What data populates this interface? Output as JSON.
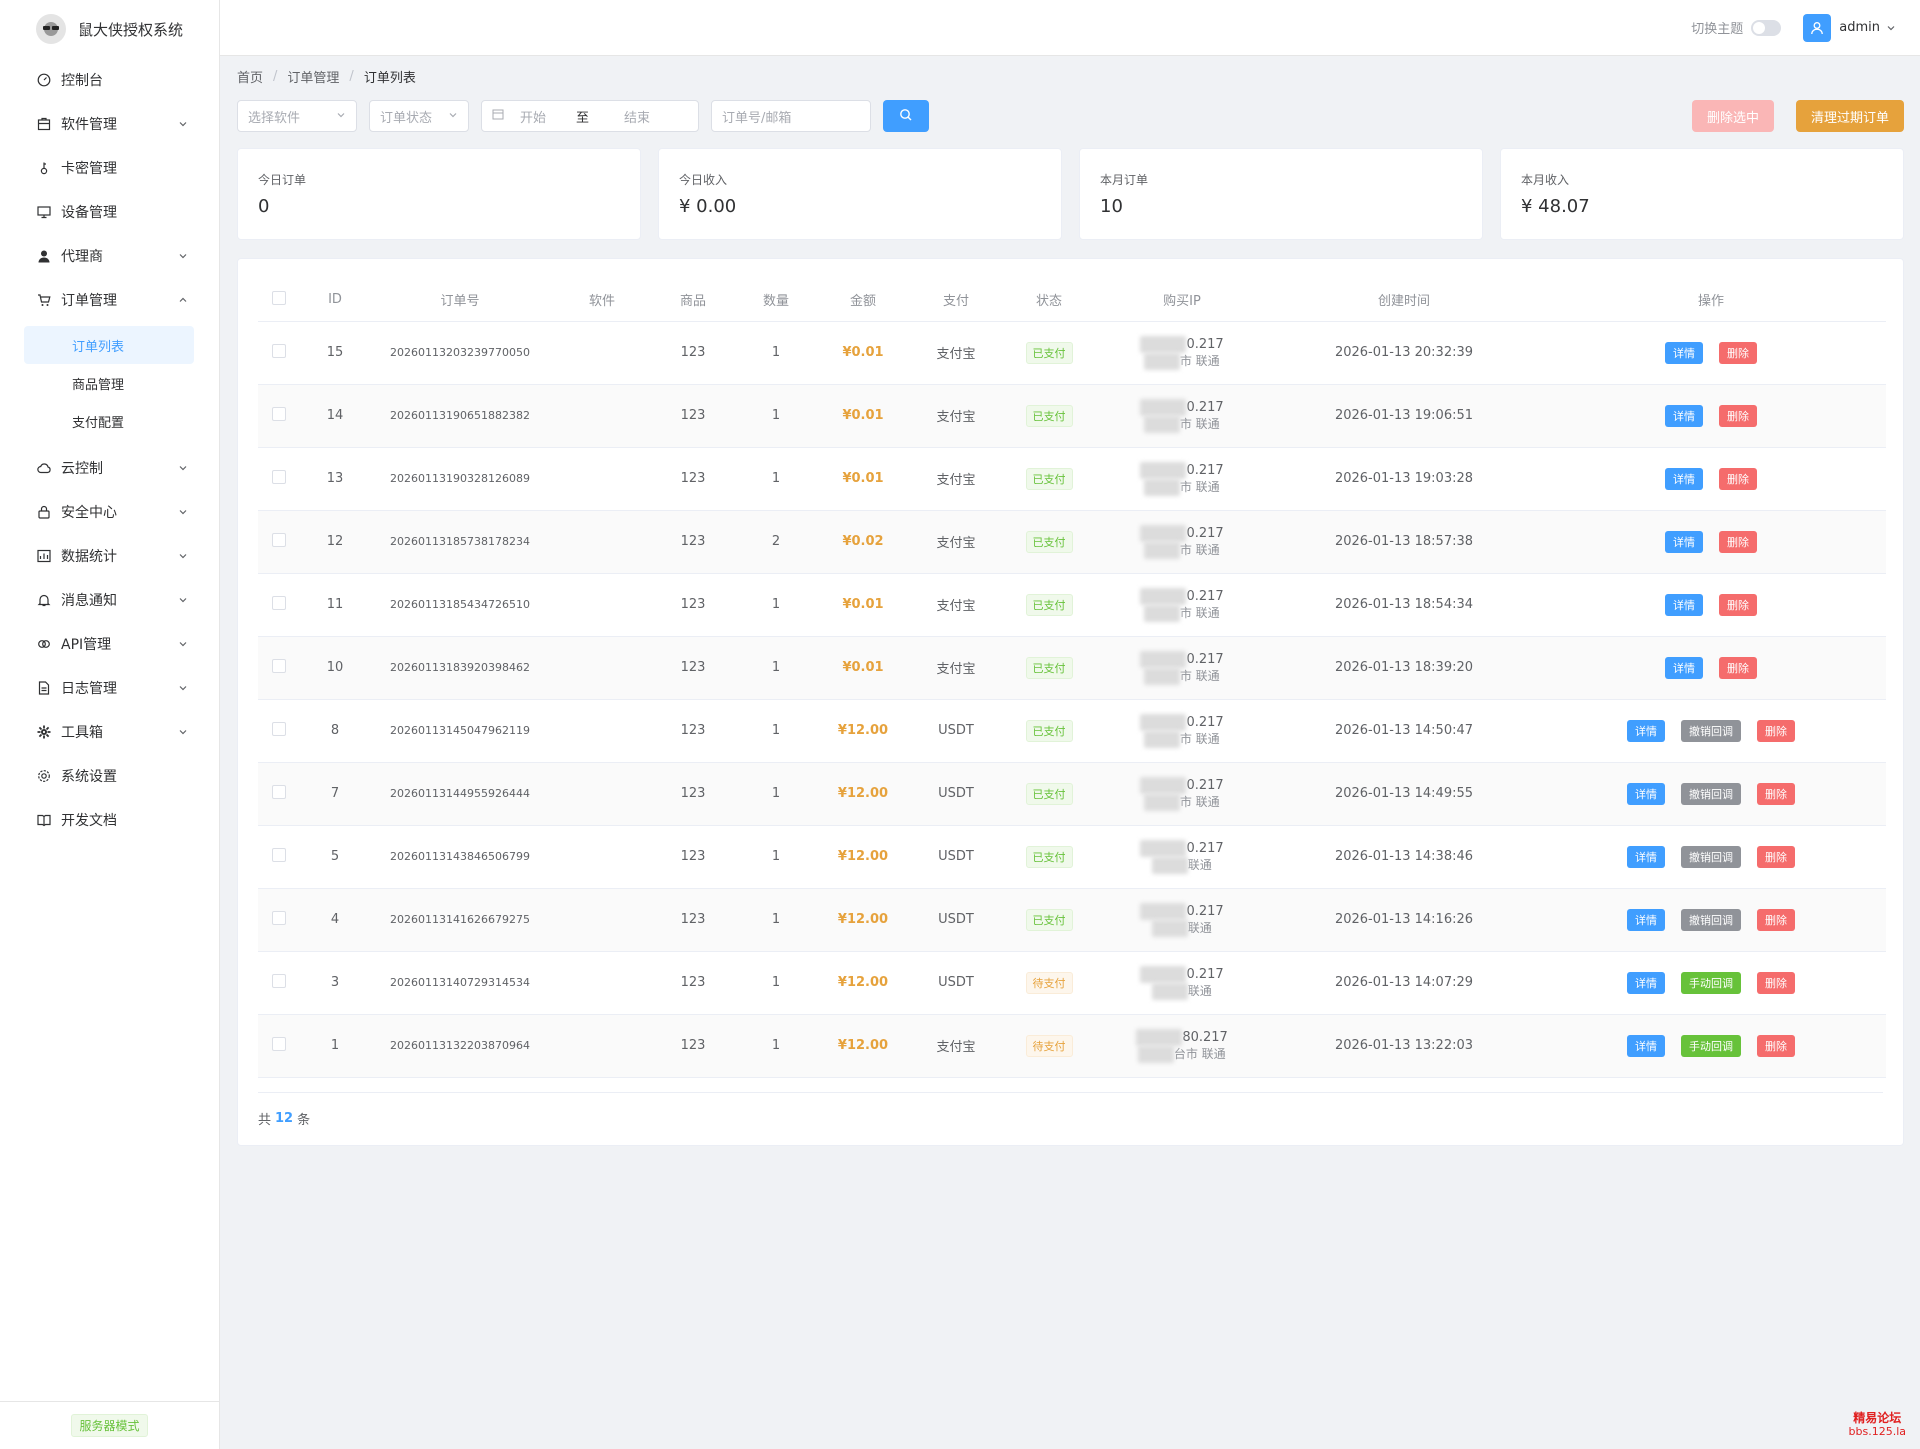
{
  "app": {
    "title": "鼠大侠授权系统"
  },
  "sidebar": {
    "items": [
      {
        "label": "控制台",
        "icon": "dashboard-icon",
        "arrow": false
      },
      {
        "label": "软件管理",
        "icon": "package-icon",
        "arrow": true
      },
      {
        "label": "卡密管理",
        "icon": "key-icon",
        "arrow": false
      },
      {
        "label": "设备管理",
        "icon": "monitor-icon",
        "arrow": false
      },
      {
        "label": "代理商",
        "icon": "user-icon",
        "arrow": true
      },
      {
        "label": "订单管理",
        "icon": "cart-icon",
        "arrow": true,
        "expanded": true
      },
      {
        "label": "云控制",
        "icon": "cloud-icon",
        "arrow": true
      },
      {
        "label": "安全中心",
        "icon": "lock-icon",
        "arrow": true
      },
      {
        "label": "数据统计",
        "icon": "chart-icon",
        "arrow": true
      },
      {
        "label": "消息通知",
        "icon": "bell-icon",
        "arrow": true
      },
      {
        "label": "API管理",
        "icon": "link-icon",
        "arrow": true
      },
      {
        "label": "日志管理",
        "icon": "document-icon",
        "arrow": true
      },
      {
        "label": "工具箱",
        "icon": "tools-icon",
        "arrow": true
      },
      {
        "label": "系统设置",
        "icon": "gear-icon",
        "arrow": false
      },
      {
        "label": "开发文档",
        "icon": "book-icon",
        "arrow": false
      }
    ],
    "order_sub": [
      {
        "label": "订单列表",
        "active": true
      },
      {
        "label": "商品管理",
        "active": false
      },
      {
        "label": "支付配置",
        "active": false
      }
    ],
    "footer_badge": "服务器模式"
  },
  "header": {
    "theme_label": "切换主题",
    "user": "admin"
  },
  "breadcrumb": [
    "首页",
    "订单管理",
    "订单列表"
  ],
  "filters": {
    "software_placeholder": "选择软件",
    "status_placeholder": "订单状态",
    "date_start": "开始",
    "date_to": "至",
    "date_end": "结束",
    "search_placeholder": "订单号/邮箱"
  },
  "actions": {
    "delete_selected": "删除选中",
    "clean_expired": "清理过期订单"
  },
  "stats": [
    {
      "label": "今日订单",
      "value": "0"
    },
    {
      "label": "今日收入",
      "value": "¥ 0.00"
    },
    {
      "label": "本月订单",
      "value": "10"
    },
    {
      "label": "本月收入",
      "value": "¥ 48.07"
    }
  ],
  "table": {
    "columns": [
      "ID",
      "订单号",
      "软件",
      "商品",
      "数量",
      "金额",
      "支付",
      "状态",
      "购买IP",
      "创建时间",
      "操作"
    ],
    "ip_line2_suffix": "市 联通",
    "rows": [
      {
        "id": "15",
        "order_no": "20260113203239770050",
        "software": "",
        "product": "123",
        "qty": "1",
        "amount": "¥0.01",
        "pay": "支付宝",
        "status": "已支付",
        "status_type": "paid",
        "ip": "0.217",
        "ip2": "市 联通",
        "time": "2026-01-13 20:32:39",
        "ops": [
          "详情",
          "删除"
        ]
      },
      {
        "id": "14",
        "order_no": "20260113190651882382",
        "software": "",
        "product": "123",
        "qty": "1",
        "amount": "¥0.01",
        "pay": "支付宝",
        "status": "已支付",
        "status_type": "paid",
        "ip": "0.217",
        "ip2": "市 联通",
        "time": "2026-01-13 19:06:51",
        "ops": [
          "详情",
          "删除"
        ]
      },
      {
        "id": "13",
        "order_no": "20260113190328126089",
        "software": "",
        "product": "123",
        "qty": "1",
        "amount": "¥0.01",
        "pay": "支付宝",
        "status": "已支付",
        "status_type": "paid",
        "ip": "0.217",
        "ip2": "市 联通",
        "time": "2026-01-13 19:03:28",
        "ops": [
          "详情",
          "删除"
        ]
      },
      {
        "id": "12",
        "order_no": "20260113185738178234",
        "software": "",
        "product": "123",
        "qty": "2",
        "amount": "¥0.02",
        "pay": "支付宝",
        "status": "已支付",
        "status_type": "paid",
        "ip": "0.217",
        "ip2": "市 联通",
        "time": "2026-01-13 18:57:38",
        "ops": [
          "详情",
          "删除"
        ]
      },
      {
        "id": "11",
        "order_no": "20260113185434726510",
        "software": "",
        "product": "123",
        "qty": "1",
        "amount": "¥0.01",
        "pay": "支付宝",
        "status": "已支付",
        "status_type": "paid",
        "ip": "0.217",
        "ip2": "市 联通",
        "time": "2026-01-13 18:54:34",
        "ops": [
          "详情",
          "删除"
        ]
      },
      {
        "id": "10",
        "order_no": "20260113183920398462",
        "software": "",
        "product": "123",
        "qty": "1",
        "amount": "¥0.01",
        "pay": "支付宝",
        "status": "已支付",
        "status_type": "paid",
        "ip": "0.217",
        "ip2": "市 联通",
        "time": "2026-01-13 18:39:20",
        "ops": [
          "详情",
          "删除"
        ]
      },
      {
        "id": "8",
        "order_no": "20260113145047962119",
        "software": "",
        "product": "123",
        "qty": "1",
        "amount": "¥12.00",
        "pay": "USDT",
        "status": "已支付",
        "status_type": "paid",
        "ip": "0.217",
        "ip2": "市 联通",
        "time": "2026-01-13 14:50:47",
        "ops": [
          "详情",
          "撤销回调",
          "删除"
        ]
      },
      {
        "id": "7",
        "order_no": "20260113144955926444",
        "software": "",
        "product": "123",
        "qty": "1",
        "amount": "¥12.00",
        "pay": "USDT",
        "status": "已支付",
        "status_type": "paid",
        "ip": "0.217",
        "ip2": "市 联通",
        "time": "2026-01-13 14:49:55",
        "ops": [
          "详情",
          "撤销回调",
          "删除"
        ]
      },
      {
        "id": "5",
        "order_no": "20260113143846506799",
        "software": "",
        "product": "123",
        "qty": "1",
        "amount": "¥12.00",
        "pay": "USDT",
        "status": "已支付",
        "status_type": "paid",
        "ip": "0.217",
        "ip2": "联通",
        "time": "2026-01-13 14:38:46",
        "ops": [
          "详情",
          "撤销回调",
          "删除"
        ]
      },
      {
        "id": "4",
        "order_no": "20260113141626679275",
        "software": "",
        "product": "123",
        "qty": "1",
        "amount": "¥12.00",
        "pay": "USDT",
        "status": "已支付",
        "status_type": "paid",
        "ip": "0.217",
        "ip2": "联通",
        "time": "2026-01-13 14:16:26",
        "ops": [
          "详情",
          "撤销回调",
          "删除"
        ]
      },
      {
        "id": "3",
        "order_no": "20260113140729314534",
        "software": "",
        "product": "123",
        "qty": "1",
        "amount": "¥12.00",
        "pay": "USDT",
        "status": "待支付",
        "status_type": "pending",
        "ip": "0.217",
        "ip2": "联通",
        "time": "2026-01-13 14:07:29",
        "ops": [
          "详情",
          "手动回调",
          "删除"
        ]
      },
      {
        "id": "1",
        "order_no": "20260113132203870964",
        "software": "",
        "product": "123",
        "qty": "1",
        "amount": "¥12.00",
        "pay": "支付宝",
        "status": "待支付",
        "status_type": "pending",
        "ip": "80.217",
        "ip2": "台市 联通",
        "time": "2026-01-13 13:22:03",
        "ops": [
          "详情",
          "手动回调",
          "删除"
        ]
      }
    ]
  },
  "pagination": {
    "prefix": "共",
    "total": "12",
    "suffix": "条"
  },
  "watermark": {
    "line1": "精易论坛",
    "line2": "bbs.125.la"
  },
  "colors": {
    "primary": "#409eff",
    "success": "#67c23a",
    "warning": "#e6a23c",
    "danger": "#f56c6c",
    "info": "#909399"
  }
}
